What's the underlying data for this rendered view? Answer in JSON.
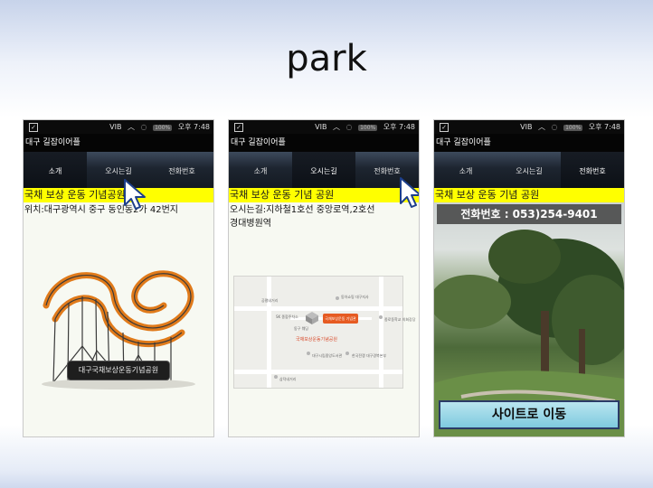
{
  "slide_title": "park",
  "status_bar": {
    "left_glyph": "✓",
    "network": "VIB",
    "pill": "100%",
    "time": "오후 7:48"
  },
  "app_title": "대구 길잡이어플",
  "tabs": [
    "소개",
    "오시는길",
    "전화번호"
  ],
  "phones": [
    {
      "banner": "국채 보상 운동 기념공원",
      "body_lines": [
        "위치:대구광역시 중구 동인동2가 42번지"
      ],
      "caption": "대구국채보상운동기념공원"
    },
    {
      "banner": "국채 보상 운동 기념 공원",
      "body_lines": [
        "오시는길:지하철1호선 중앙로역,2호선",
        "경대병원역"
      ],
      "map": {
        "badge": "국채보상운동 기념관",
        "park_label": "국채보상운동기념공원",
        "labels": [
          "공평네거리",
          "SK 종합주차소",
          "동구 웨딩",
          "동아쇼핑 대구지사",
          "종로동학교 의회강당",
          "대구시립중앙도서관",
          "한국전쟁 대구경북본부",
          "삼덕네거리"
        ]
      }
    },
    {
      "banner": "국채 보상 운동 기념 공원",
      "phone_text": "전화번호 : 053)254-9401",
      "site_button": "사이트로 이동"
    }
  ]
}
